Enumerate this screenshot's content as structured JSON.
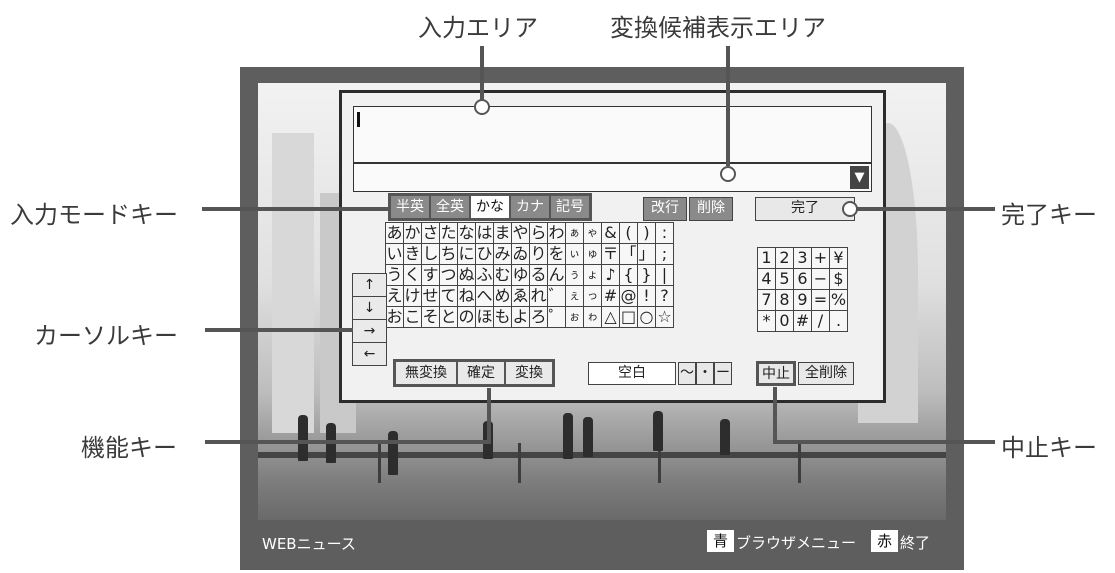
{
  "callouts": {
    "input_area": "入力エリア",
    "candidate_area": "変換候補表示エリア",
    "mode_keys": "入力モードキー",
    "cursor_keys": "カーソルキー",
    "function_keys": "機能キー",
    "done_key": "完了キー",
    "cancel_key": "中止キー"
  },
  "mode_keys": [
    "半英",
    "全英",
    "かな",
    "カナ",
    "記号"
  ],
  "mode_selected": "かな",
  "edit_keys": {
    "newline": "改行",
    "delete": "削除",
    "done": "完了"
  },
  "candidate_arrow_icon": "▼",
  "kana_rows": [
    [
      "あ",
      "か",
      "さ",
      "た",
      "な",
      "は",
      "ま",
      "や",
      "ら",
      "わ",
      "ぁ",
      "ゃ",
      "&",
      "(",
      ")",
      ":"
    ],
    [
      "い",
      "き",
      "し",
      "ち",
      "に",
      "ひ",
      "み",
      "ゐ",
      "り",
      "を",
      "ぃ",
      "ゅ",
      "〒",
      "「",
      "」",
      ";"
    ],
    [
      "う",
      "く",
      "す",
      "つ",
      "ぬ",
      "ふ",
      "む",
      "ゆ",
      "る",
      "ん",
      "ぅ",
      "ょ",
      "♪",
      "{",
      "}",
      "|"
    ],
    [
      "え",
      "け",
      "せ",
      "て",
      "ね",
      "へ",
      "め",
      "ゑ",
      "れ",
      "゛",
      "ぇ",
      "っ",
      "#",
      "@",
      "!",
      "?"
    ],
    [
      "お",
      "こ",
      "そ",
      "と",
      "の",
      "ほ",
      "も",
      "よ",
      "ろ",
      "゜",
      "ぉ",
      "ゎ",
      "△",
      "□",
      "○",
      "☆"
    ]
  ],
  "numeric_rows": [
    [
      "1",
      "2",
      "3",
      "+",
      "¥"
    ],
    [
      "4",
      "5",
      "6",
      "−",
      "$"
    ],
    [
      "7",
      "8",
      "9",
      "=",
      "%"
    ],
    [
      "*",
      "0",
      "#",
      "/",
      "."
    ]
  ],
  "cursor_keys": [
    "↑",
    "↓",
    "→",
    "←"
  ],
  "function_keys": [
    "無変換",
    "確定",
    "変換"
  ],
  "space_key": "空白",
  "small_symbol_keys": [
    "〜",
    "・",
    "ー"
  ],
  "cancel_keys": {
    "cancel": "中止",
    "clear_all": "全削除"
  },
  "status_bar": {
    "left": "WEBニュース",
    "blue_tag": "青",
    "blue_label": "ブラウザメニュー",
    "red_tag": "赤",
    "red_label": "終了"
  }
}
